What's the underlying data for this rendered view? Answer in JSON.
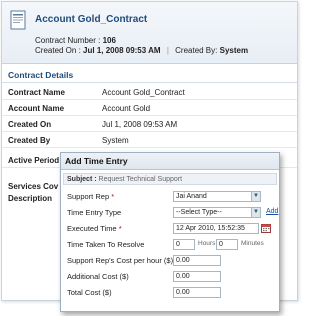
{
  "record": {
    "title": "Account Gold_Contract",
    "contract_number_label": "Contract Number :",
    "contract_number": "106",
    "created_on_label": "Created On :",
    "created_on": "Jul 1, 2008 09:53 AM",
    "created_by_label": "Created By:",
    "created_by": "System"
  },
  "details": {
    "section_title": "Contract Details",
    "rows": [
      {
        "label": "Contract Name",
        "value": "Account Gold_Contract"
      },
      {
        "label": "Account Name",
        "value": "Account Gold"
      },
      {
        "label": "Created On",
        "value": "Jul 1, 2008 09:53 AM"
      },
      {
        "label": "Created By",
        "value": "System"
      },
      {
        "label": "Active Period",
        "value": ""
      },
      {
        "label": "Services Cov",
        "value": ""
      },
      {
        "label": "Description",
        "value": ""
      }
    ]
  },
  "dialog": {
    "title": "Add Time Entry",
    "subject_label": "Subject :",
    "subject_value": "Request Technical Support",
    "fields": {
      "support_rep_label": "Support Rep",
      "support_rep_value": "Jai Anand",
      "entry_type_label": "Time Entry Type",
      "entry_type_value": "--Select Type--",
      "add_link": "Add",
      "executed_label": "Executed Time",
      "executed_value": "12 Apr 2010, 15:52:35",
      "taken_label": "Time Taken To Resolve",
      "hours_value": "0",
      "hours_unit": "Hours",
      "minutes_value": "0",
      "minutes_unit": "Minutes",
      "rate_label": "Support Rep's Cost per hour ($)",
      "rate_value": "0.00",
      "additional_label": "Additional Cost ($)",
      "additional_value": "0.00",
      "total_label": "Total Cost ($)",
      "total_value": "0.00"
    },
    "required_mark": "*"
  },
  "colors": {
    "accent": "#1f4d7a",
    "required": "#cc0000",
    "link": "#1a4fa0"
  }
}
